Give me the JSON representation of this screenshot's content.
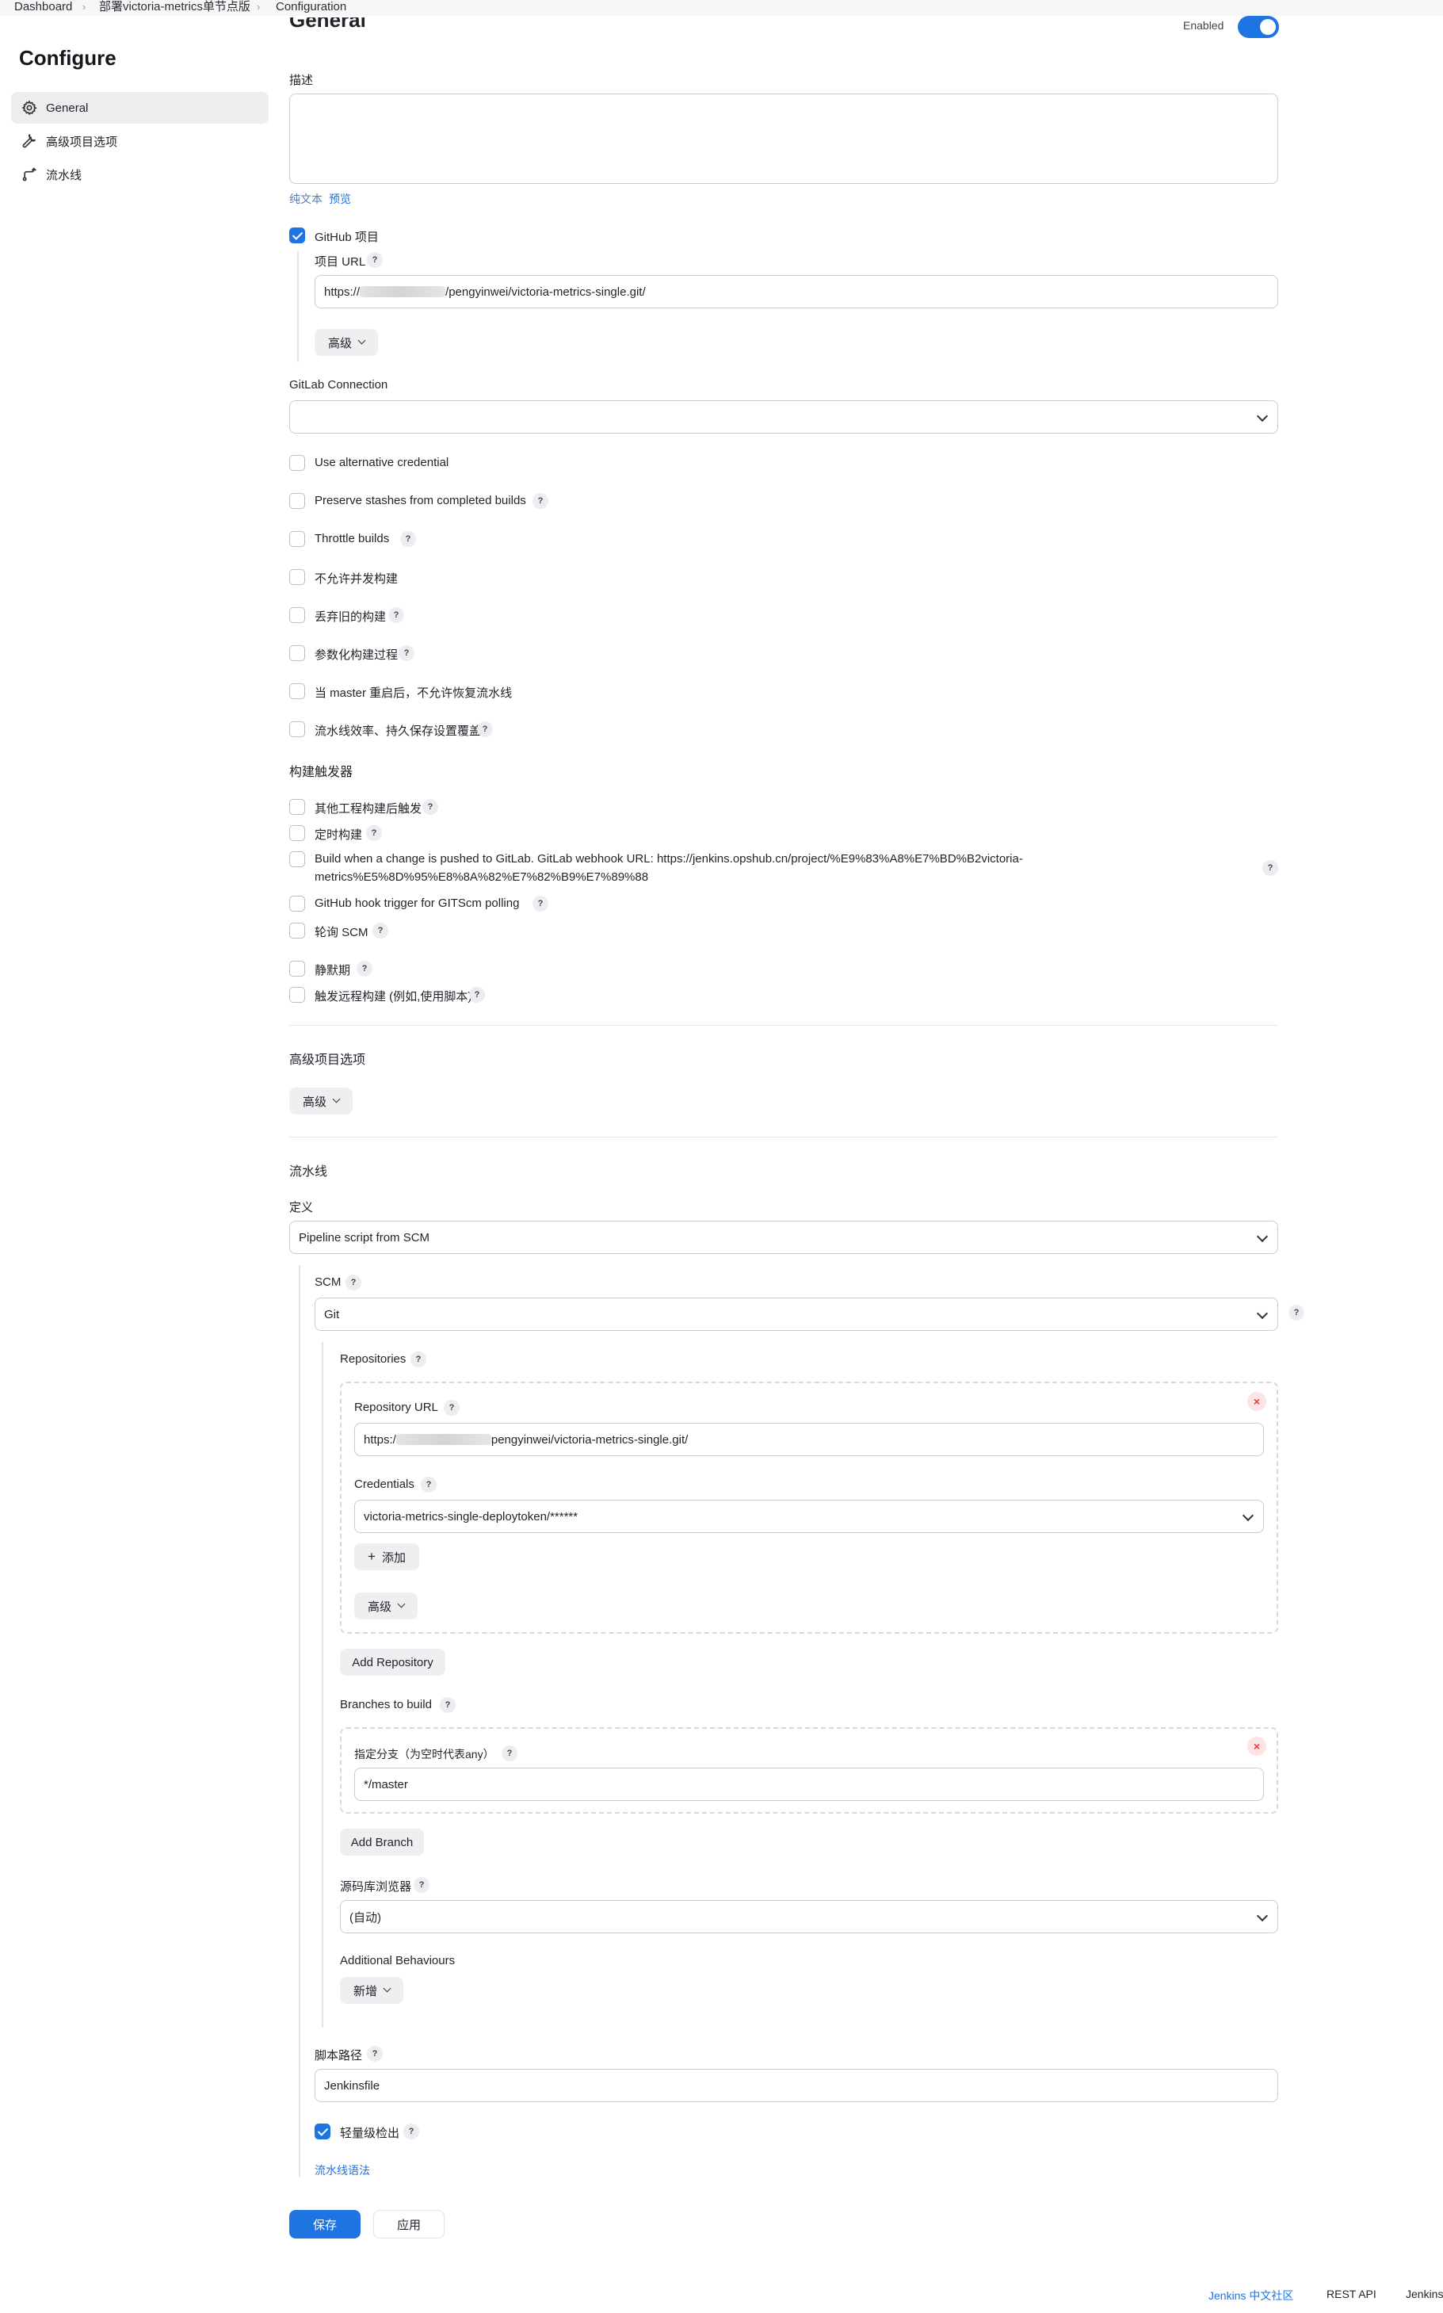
{
  "breadcrumb": [
    "Dashboard",
    "部署victoria-metrics单节点版",
    "Configuration"
  ],
  "page": {
    "title": "Configure",
    "general_heading": "General",
    "enabled_label": "Enabled"
  },
  "sidebar": {
    "items": [
      {
        "label": "General",
        "icon": "gear-icon",
        "active": true
      },
      {
        "label": "高级项目选项",
        "icon": "wrench-icon",
        "active": false
      },
      {
        "label": "流水线",
        "icon": "pipeline-icon",
        "active": false
      }
    ]
  },
  "general": {
    "description_label": "描述",
    "description_value": "",
    "plain_text": "纯文本",
    "preview": "预览",
    "github_project": {
      "label": "GitHub 项目",
      "checked": true
    },
    "project_url_label": "项目 URL",
    "project_url_prefix": "https://",
    "project_url_suffix": "/pengyinwei/victoria-metrics-single.git/",
    "advanced_label": "高级",
    "gitlab_connection_label": "GitLab Connection",
    "gitlab_connection_value": "",
    "options": [
      {
        "label": "Use alternative credential",
        "checked": false,
        "help": false
      },
      {
        "label": "Preserve stashes from completed builds",
        "checked": false,
        "help": true
      },
      {
        "label": "Throttle builds",
        "checked": false,
        "help": true
      },
      {
        "label": "不允许并发构建",
        "checked": false,
        "help": false
      },
      {
        "label": "丢弃旧的构建",
        "checked": false,
        "help": true
      },
      {
        "label": "参数化构建过程",
        "checked": false,
        "help": true
      },
      {
        "label": "当 master 重启后，不允许恢复流水线",
        "checked": false,
        "help": false
      },
      {
        "label": "流水线效率、持久保存设置覆盖",
        "checked": false,
        "help": true
      }
    ]
  },
  "triggers": {
    "title": "构建触发器",
    "items": [
      {
        "label": "其他工程构建后触发",
        "checked": false
      },
      {
        "label": "定时构建",
        "checked": false
      },
      {
        "label": "Build when a change is pushed to GitLab. GitLab webhook URL: https://jenkins.opshub.cn/project/%E9%83%A8%E7%BD%B2victoria-",
        "line2": "metrics%E5%8D%95%E8%8A%82%E7%82%B9%E7%89%88",
        "checked": false
      },
      {
        "label": "GitHub hook trigger for GITScm polling",
        "checked": false
      },
      {
        "label": "轮询 SCM",
        "checked": false
      },
      {
        "label": "静默期",
        "checked": false
      },
      {
        "label": "触发远程构建 (例如,使用脚本)",
        "checked": false
      }
    ]
  },
  "advanced_project": {
    "title": "高级项目选项",
    "button": "高级"
  },
  "pipeline": {
    "title": "流水线",
    "definition_label": "定义",
    "definition_value": "Pipeline script from SCM",
    "scm_label": "SCM",
    "scm_value": "Git",
    "repositories_label": "Repositories",
    "repo_url_label": "Repository URL",
    "repo_url_prefix": "https:/",
    "repo_url_suffix": "pengyinwei/victoria-metrics-single.git/",
    "credentials_label": "Credentials",
    "credentials_value": "victoria-metrics-single-deploytoken/******",
    "add_label": "添加",
    "advanced_label": "高级",
    "add_repository": "Add Repository",
    "branches_label": "Branches to build",
    "branch_specifier_label": "指定分支（为空时代表any）",
    "branch_value": "*/master",
    "add_branch": "Add Branch",
    "repo_browser_label": "源码库浏览器",
    "repo_browser_value": "(自动)",
    "additional_behaviours": "Additional Behaviours",
    "new_label": "新增",
    "script_path_label": "脚本路径",
    "script_path_value": "Jenkinsfile",
    "lightweight_checkout": {
      "label": "轻量级检出",
      "checked": true
    },
    "syntax_link": "流水线语法"
  },
  "actions": {
    "save": "保存",
    "apply": "应用"
  },
  "footer": {
    "community": "Jenkins 中文社区",
    "rest_api": "REST API",
    "version": "Jenkins"
  },
  "colors": {
    "accent": "#1e74e0",
    "danger": "#e23c3c"
  }
}
